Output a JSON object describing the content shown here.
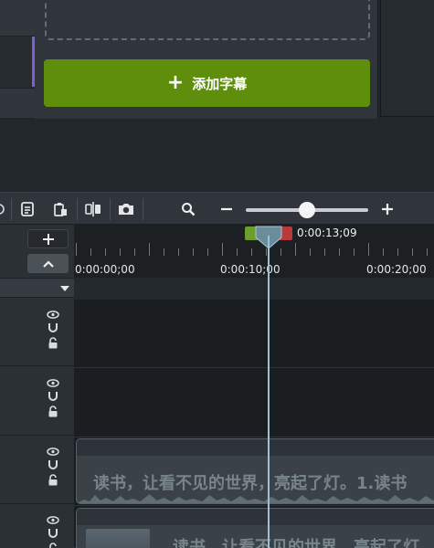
{
  "captions_panel": {
    "add_caption_label": "添加字幕",
    "add_caption_icon": "plus-icon"
  },
  "toolbar": {
    "icons": [
      "notes-icon",
      "paste-icon",
      "split-icon",
      "snapshot-icon",
      "search-icon",
      "zoom-out-icon",
      "zoom-in-icon"
    ],
    "zoom_level": 0.5
  },
  "timeline": {
    "playhead_time": "0:00:13;09",
    "ruler_labels": [
      "0:00:00;00",
      "0:00:10;00",
      "0:00:20;00"
    ],
    "add_track_icon": "plus-icon",
    "collapse_icon": "chevron-up-icon"
  },
  "tracks": [
    {
      "clip_text": ""
    },
    {
      "clip_text": ""
    },
    {
      "clip_text": "读书，让看不见的世界，亮起了灯。1.读书"
    },
    {
      "clip_text": "读书，让看不见的世界，亮起了灯"
    }
  ],
  "colors": {
    "accent_green": "#5e8e0c",
    "playhead": "#9dc3d3",
    "track_purple": "#7d5fd0"
  }
}
